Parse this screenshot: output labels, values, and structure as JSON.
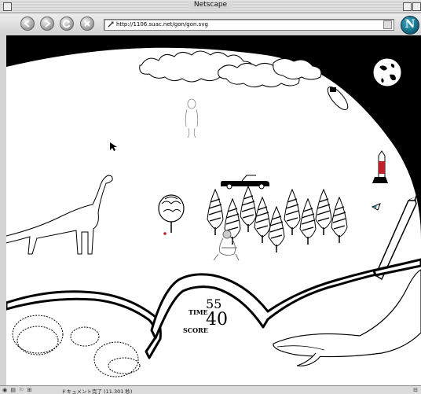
{
  "window": {
    "title": "Netscape"
  },
  "toolbar": {
    "url": "http://1106.suac.net/gon/gon.svg",
    "logo_letter": "N"
  },
  "game": {
    "time_label": "TIME",
    "time_value": "55",
    "score_label": "SCORE",
    "score_value": "40"
  },
  "statusbar": {
    "text": "ドキュメント完了 (11.301 秒)"
  },
  "colors": {
    "page_background": "#000000",
    "scene_fill": "#ffffff",
    "rocket_accent": "#c0202a",
    "bird_accent": "#2a8a9a"
  }
}
